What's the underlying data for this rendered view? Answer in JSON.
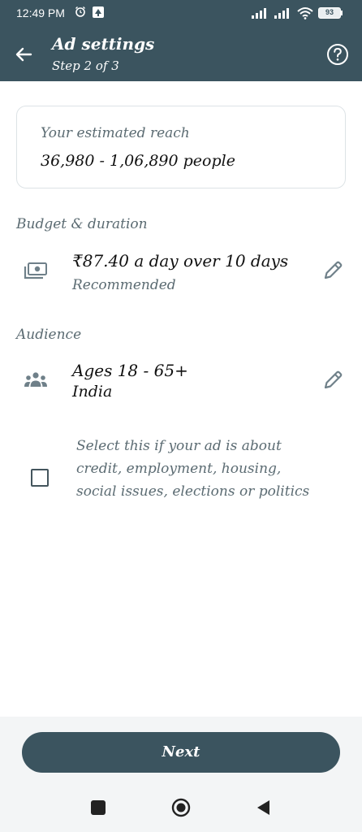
{
  "status_bar": {
    "time": "12:49 PM",
    "battery": "93"
  },
  "app_bar": {
    "title": "Ad settings",
    "subtitle": "Step 2 of 3",
    "icons": {
      "back": "back-arrow-icon",
      "help": "help-icon"
    }
  },
  "reach": {
    "label": "Your estimated reach",
    "value": "36,980 - 1,06,890 people"
  },
  "budget": {
    "section_label": "Budget & duration",
    "primary": "₹87.40 a day over 10 days",
    "secondary": "Recommended",
    "icon": "money-icon"
  },
  "audience": {
    "section_label": "Audience",
    "primary": "Ages 18 - 65+",
    "secondary": "India",
    "icon": "people-icon"
  },
  "special_category": {
    "checked": false,
    "text": "Select this if your ad is about credit, employment, housing, social issues, elections or politics"
  },
  "footer": {
    "next_label": "Next"
  },
  "colors": {
    "primary": "#3b545f",
    "secondary_text": "#5b6b72",
    "background": "#ffffff",
    "footer_background": "#f3f5f6"
  }
}
